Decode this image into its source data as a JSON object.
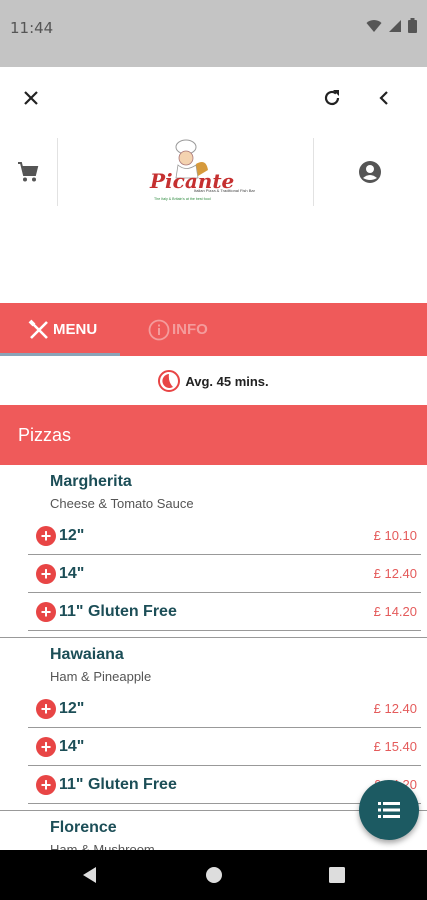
{
  "status_bar": {
    "time": "11:44",
    "icons": [
      "wifi-icon",
      "signal-icon",
      "battery-icon"
    ]
  },
  "top_bar": {
    "icons": [
      "close-icon",
      "refresh-icon",
      "back-chevron-icon"
    ]
  },
  "header": {
    "logo_text": "Picante",
    "logo_subtitle": "Italian Pizza & Traditional Fish Bar",
    "logo_tagline": "The Italy & Britain's at the best food",
    "icons": [
      "cart-icon",
      "account-icon"
    ]
  },
  "tabs": [
    {
      "label": "MENU",
      "icon": "utensils-icon",
      "active": true
    },
    {
      "label": "INFO",
      "icon": "info-icon",
      "active": false
    }
  ],
  "delivery": {
    "text": "Avg. 45 mins.",
    "icon": "timer-icon"
  },
  "category": {
    "title": "Pizzas"
  },
  "items": [
    {
      "name": "Margherita",
      "description": "Cheese & Tomato Sauce",
      "options": [
        {
          "label": "12\"",
          "price": "£ 10.10"
        },
        {
          "label": "14\"",
          "price": "£ 12.40"
        },
        {
          "label": "11\" Gluten Free",
          "price": "£ 14.20"
        }
      ]
    },
    {
      "name": "Hawaiana",
      "description": "Ham & Pineapple",
      "options": [
        {
          "label": "12\"",
          "price": "£ 12.40"
        },
        {
          "label": "14\"",
          "price": "£ 15.40"
        },
        {
          "label": "11\" Gluten Free",
          "price": "£ 14.20"
        }
      ]
    },
    {
      "name": "Florence",
      "description": "Ham & Mushroom",
      "options": []
    }
  ],
  "fab": {
    "icon": "list-icon"
  },
  "nav_bar": {
    "icons": [
      "nav-back-icon",
      "nav-home-icon",
      "nav-recents-icon"
    ]
  },
  "colors": {
    "accent": "#ef5a5a",
    "primary_dark": "#1c5a62",
    "price": "#e45b5b",
    "item_text": "#1c4e57"
  }
}
